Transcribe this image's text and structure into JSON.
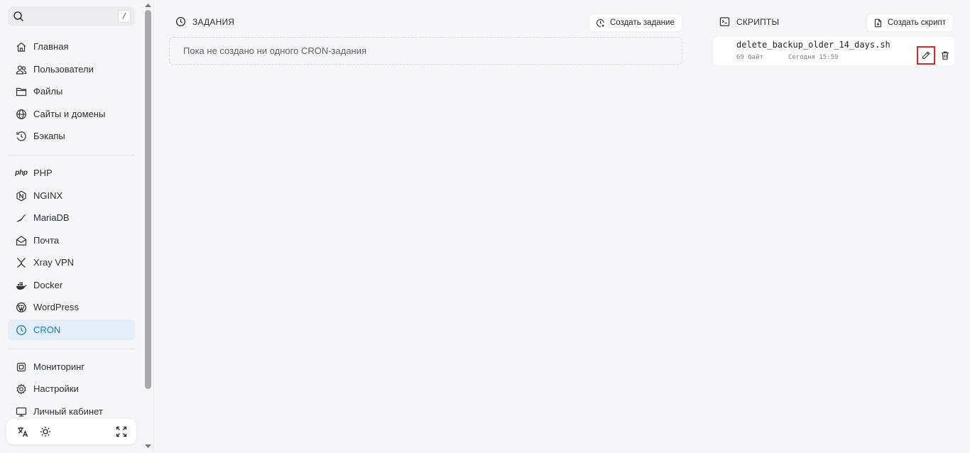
{
  "search": {
    "shortcut": "/"
  },
  "sidebar": {
    "group1": [
      {
        "label": "Главная",
        "icon": "home-icon"
      },
      {
        "label": "Пользователи",
        "icon": "users-icon"
      },
      {
        "label": "Файлы",
        "icon": "folder-icon"
      },
      {
        "label": "Сайты и домены",
        "icon": "globe-icon"
      },
      {
        "label": "Бэкапы",
        "icon": "history-icon"
      }
    ],
    "group2": [
      {
        "label": "PHP",
        "icon": "php-icon"
      },
      {
        "label": "NGINX",
        "icon": "nginx-icon"
      },
      {
        "label": "MariaDB",
        "icon": "mariadb-icon"
      },
      {
        "label": "Почта",
        "icon": "mail-icon"
      },
      {
        "label": "Xray VPN",
        "icon": "xray-icon"
      },
      {
        "label": "Docker",
        "icon": "docker-icon"
      },
      {
        "label": "WordPress",
        "icon": "wordpress-icon"
      },
      {
        "label": "CRON",
        "icon": "clock-icon",
        "active": true
      }
    ],
    "group3": [
      {
        "label": "Мониторинг",
        "icon": "cpu-icon"
      },
      {
        "label": "Настройки",
        "icon": "settings-icon"
      },
      {
        "label": "Личный кабинет",
        "icon": "monitor-icon"
      }
    ],
    "php_glyph": "php"
  },
  "jobs": {
    "title": "ЗАДАНИЯ",
    "create_label": "Создать задание",
    "empty_text": "Пока не создано ни одного CRON-задания"
  },
  "scripts": {
    "title": "СКРИПТЫ",
    "create_label": "Создать скрипт",
    "items": [
      {
        "name": "delete_backup_older_14_days.sh",
        "size": "69 байт",
        "modified": "Сегодня 15:59"
      }
    ]
  },
  "colors": {
    "accent": "#1f7ab8",
    "active_bg": "#e3eef8",
    "highlight": "#d62a2a"
  }
}
